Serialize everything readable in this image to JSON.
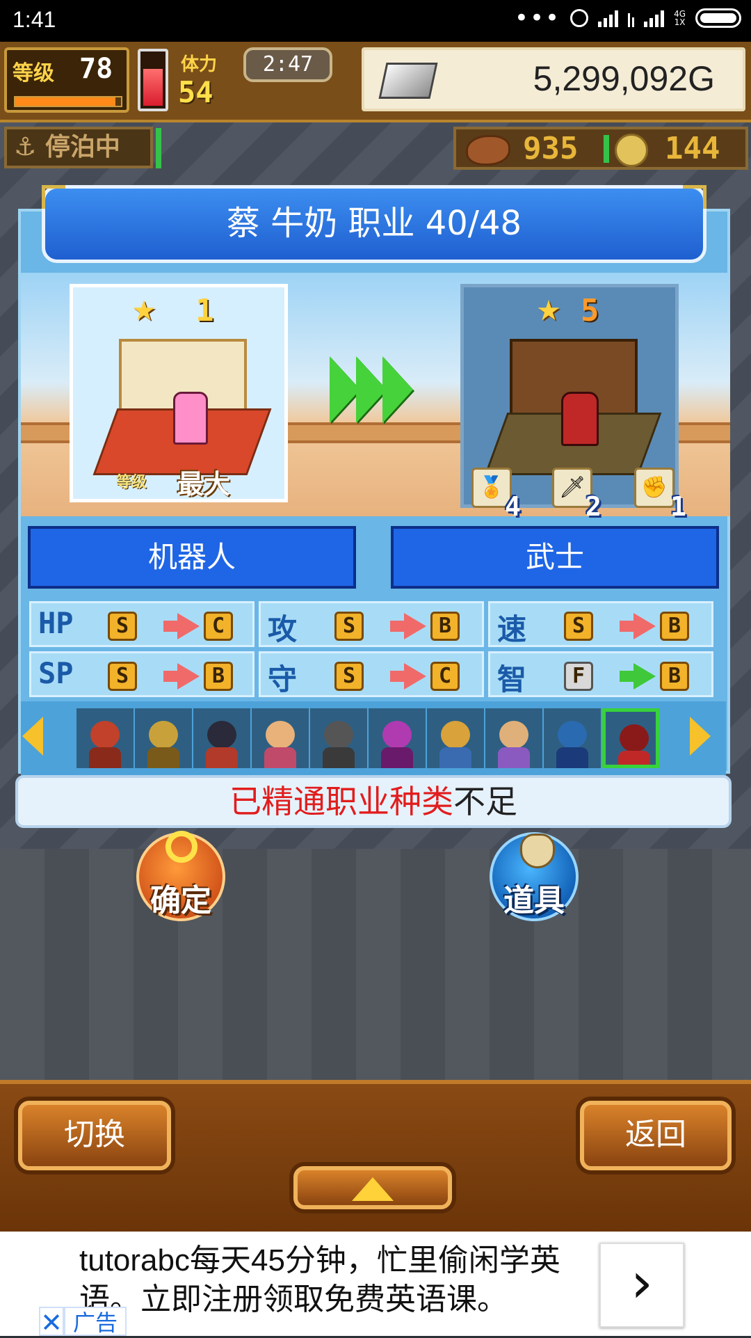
{
  "status_bar": {
    "time": "1:41",
    "network": "4G\n1X"
  },
  "hud": {
    "level_label": "等级",
    "level_value": "78",
    "xp_progress": 0.95,
    "stamina_level": 0.75,
    "stamina_label": "体力",
    "stamina_value": "54",
    "timer": "2:47",
    "gold": "5,299,092G",
    "moored_label": "停泊中",
    "food_value": "935",
    "coin_value": "144"
  },
  "panel": {
    "title": "蔡 牛奶  职业 40/48",
    "current_job": {
      "rank": "1",
      "level_label": "等级",
      "max_label": "最大"
    },
    "next_job": {
      "rank": "5",
      "skills": [
        {
          "icon": "medal-icon",
          "count": "4"
        },
        {
          "icon": "sword-icon",
          "count": "2"
        },
        {
          "icon": "fist-icon",
          "count": "1"
        }
      ]
    },
    "from_job": "机器人",
    "to_job": "武士",
    "stats": [
      {
        "label": "HP",
        "from": "S",
        "to": "C",
        "up": false
      },
      {
        "label": "攻",
        "from": "S",
        "to": "B",
        "up": false
      },
      {
        "label": "速",
        "from": "S",
        "to": "B",
        "up": false
      },
      {
        "label": "SP",
        "from": "S",
        "to": "B",
        "up": false
      },
      {
        "label": "守",
        "from": "S",
        "to": "C",
        "up": false
      },
      {
        "label": "智",
        "from": "F",
        "to": "B",
        "up": true
      }
    ],
    "characters": [
      {
        "head": "#c2412a",
        "body": "#8a2a1a"
      },
      {
        "head": "#c9a13a",
        "body": "#7a5a1a"
      },
      {
        "head": "#2a2a3a",
        "body": "#b23a2a"
      },
      {
        "head": "#e8b27a",
        "body": "#c04a6a"
      },
      {
        "head": "#555555",
        "body": "#3a3a3a"
      },
      {
        "head": "#b03ab0",
        "body": "#6a1a6a"
      },
      {
        "head": "#d9a23a",
        "body": "#3a6ab0"
      },
      {
        "head": "#e0b07a",
        "body": "#8a5ac0"
      },
      {
        "head": "#2a6ab0",
        "body": "#1a3a7a"
      },
      {
        "head": "#8a1a1a",
        "body": "#c02828"
      }
    ],
    "selected_index": 9,
    "warning_highlight": "已精通职业种类",
    "warning_rest": "不足"
  },
  "actions": {
    "confirm": "确定",
    "items": "道具"
  },
  "bottom": {
    "switch": "切换",
    "back": "返回"
  },
  "ad": {
    "text": "tutorabc每天45分钟，忙里偷闲学英语。立即注册领取免费英语课。",
    "go": "›",
    "close": "✕",
    "badge": "广告"
  },
  "colors": {
    "accent_blue": "#1f66e6",
    "wood": "#8a4a14",
    "highlight_red": "#e11d1d",
    "select_green": "#38d23a"
  }
}
